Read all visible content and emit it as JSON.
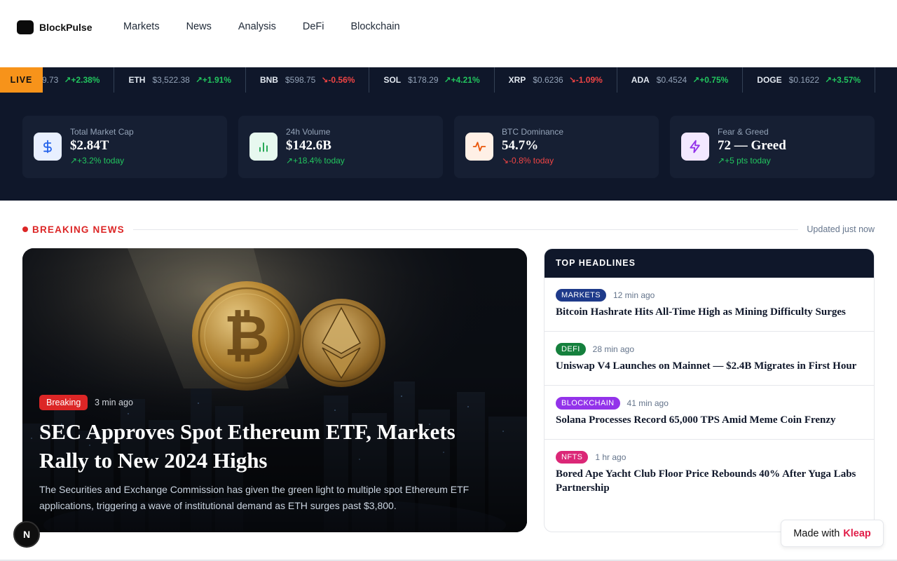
{
  "brand": {
    "name": "BlockPulse"
  },
  "nav": [
    "Markets",
    "News",
    "Analysis",
    "DeFi",
    "Blockchain"
  ],
  "ticker": {
    "live_label": "LIVE",
    "items": [
      {
        "symbol": "",
        "price": "9.73",
        "change": "+2.38%",
        "direction": "up"
      },
      {
        "symbol": "ETH",
        "price": "$3,522.38",
        "change": "+1.91%",
        "direction": "up"
      },
      {
        "symbol": "BNB",
        "price": "$598.75",
        "change": "-0.56%",
        "direction": "down"
      },
      {
        "symbol": "SOL",
        "price": "$178.29",
        "change": "+4.21%",
        "direction": "up"
      },
      {
        "symbol": "XRP",
        "price": "$0.6236",
        "change": "-1.09%",
        "direction": "down"
      },
      {
        "symbol": "ADA",
        "price": "$0.4524",
        "change": "+0.75%",
        "direction": "up"
      },
      {
        "symbol": "DOGE",
        "price": "$0.1622",
        "change": "+3.57%",
        "direction": "up"
      }
    ]
  },
  "stats": [
    {
      "label": "Total Market Cap",
      "value": "$2.84T",
      "change": "+3.2% today",
      "direction": "up",
      "icon": "dollar-icon",
      "icon_bg": "#e8efff",
      "icon_color": "#2563eb"
    },
    {
      "label": "24h Volume",
      "value": "$142.6B",
      "change": "+18.4% today",
      "direction": "up",
      "icon": "bar-chart-icon",
      "icon_bg": "#e7f8ef",
      "icon_color": "#16a34a"
    },
    {
      "label": "BTC Dominance",
      "value": "54.7%",
      "change": "-0.8% today",
      "direction": "down",
      "icon": "pulse-icon",
      "icon_bg": "#fff0e6",
      "icon_color": "#ea580c"
    },
    {
      "label": "Fear & Greed",
      "value": "72 — Greed",
      "change": "+5 pts today",
      "direction": "up",
      "icon": "lightning-icon",
      "icon_bg": "#f3e8ff",
      "icon_color": "#9333ea"
    }
  ],
  "breaking": {
    "label": "BREAKING NEWS",
    "updated": "Updated just now"
  },
  "hero": {
    "badge": "Breaking",
    "time": "3 min ago",
    "title": "SEC Approves Spot Ethereum ETF, Markets Rally to New 2024 Highs",
    "summary": "The Securities and Exchange Commission has given the green light to multiple spot Ethereum ETF applications, triggering a wave of institutional demand as ETH surges past $3,800."
  },
  "headlines": {
    "header": "TOP HEADLINES",
    "items": [
      {
        "tag": "MARKETS",
        "tag_color": "#1e3a8a",
        "time": "12 min ago",
        "title": "Bitcoin Hashrate Hits All-Time High as Mining Difficulty Surges"
      },
      {
        "tag": "DEFI",
        "tag_color": "#15803d",
        "time": "28 min ago",
        "title": "Uniswap V4 Launches on Mainnet — $2.4B Migrates in First Hour"
      },
      {
        "tag": "BLOCKCHAIN",
        "tag_color": "#9333ea",
        "time": "41 min ago",
        "title": "Solana Processes Record 65,000 TPS Amid Meme Coin Frenzy"
      },
      {
        "tag": "NFTS",
        "tag_color": "#db2777",
        "time": "1 hr ago",
        "title": "Bored Ape Yacht Club Floor Price Rebounds 40% After Yuga Labs Partnership"
      }
    ]
  },
  "footer": {
    "fab_label": "N",
    "made_with": "Made with",
    "made_brand": "Kleap"
  }
}
